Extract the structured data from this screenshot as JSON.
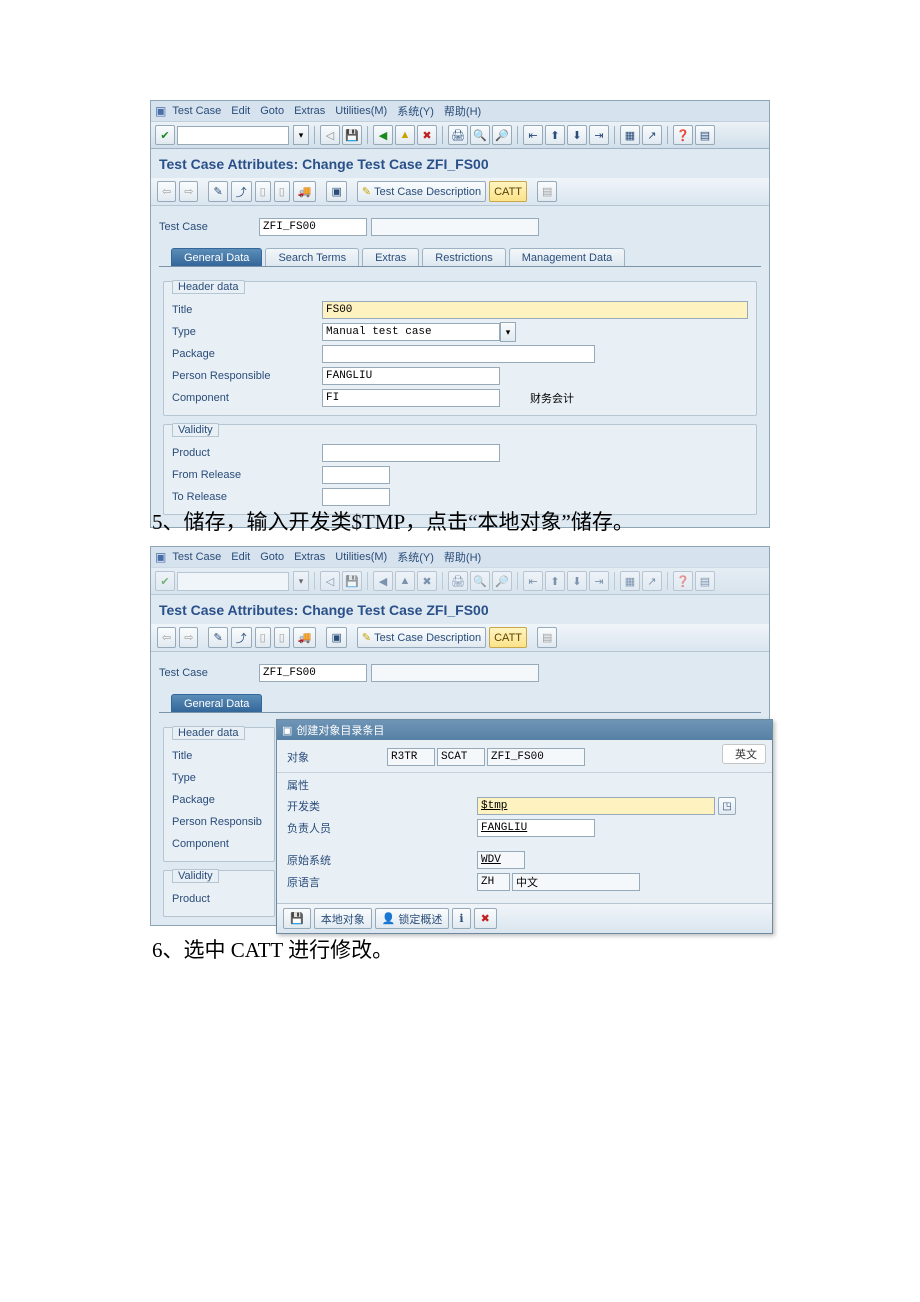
{
  "menus": {
    "testcase": "Test Case",
    "edit": "Edit",
    "goto": "Goto",
    "extras": "Extras",
    "utilities": "Utilities(M)",
    "system": "系统(Y)",
    "help": "帮助(H)"
  },
  "screen1": {
    "title": "Test Case Attributes: Change Test Case ZFI_FS00",
    "apptb": {
      "desc_btn": "Test Case Description",
      "catt_btn": "CATT"
    },
    "testcase_label": "Test Case",
    "testcase_value": "ZFI_FS00",
    "tabs": [
      "General Data",
      "Search Terms",
      "Extras",
      "Restrictions",
      "Management Data"
    ],
    "active_tab": 0,
    "group_header": "Header data",
    "rows": {
      "title_lbl": "Title",
      "title_val": "FS00",
      "type_lbl": "Type",
      "type_val": "Manual test case",
      "package_lbl": "Package",
      "package_val": "",
      "person_lbl": "Person Responsible",
      "person_val": "FANGLIU",
      "component_lbl": "Component",
      "component_val": "FI",
      "component_txt": "财务会计"
    },
    "group_validity": "Validity",
    "validity": {
      "product_lbl": "Product",
      "product_val": "",
      "from_lbl": "From Release",
      "from_val": "",
      "to_lbl": "To Release",
      "to_val": ""
    }
  },
  "caption5": "5、储存，输入开发类$TMP，点击“本地对象”储存。",
  "screen2": {
    "title": "Test Case Attributes: Change Test Case ZFI_FS00",
    "testcase_label": "Test Case",
    "testcase_value": "ZFI_FS00",
    "apptb": {
      "desc_btn": "Test Case Description",
      "catt_btn": "CATT"
    },
    "tabs": [
      "General Data"
    ],
    "group_header": "Header data",
    "labels": {
      "title": "Title",
      "type": "Type",
      "package": "Package",
      "person": "Person Responsib",
      "component": "Component"
    },
    "group_validity": "Validity",
    "validity_product": "Product",
    "dialog": {
      "title": "创建对象目录条目",
      "tag_en": "英文",
      "obj_lbl": "对象",
      "obj_v1": "R3TR",
      "obj_v2": "SCAT",
      "obj_v3": "ZFI_FS00",
      "sec_attr": "属性",
      "devclass_lbl": "开发类",
      "devclass_val": "$tmp",
      "person_lbl": "负责人员",
      "person_val": "FANGLIU",
      "origsys_lbl": "原始系统",
      "origsys_val": "WDV",
      "origlang_lbl": "原语言",
      "origlang_val": "ZH",
      "origlang_txt": "中文",
      "btn_local": "本地对象",
      "btn_lock": "锁定概述"
    }
  },
  "caption6": "6、选中 CATT 进行修改。"
}
